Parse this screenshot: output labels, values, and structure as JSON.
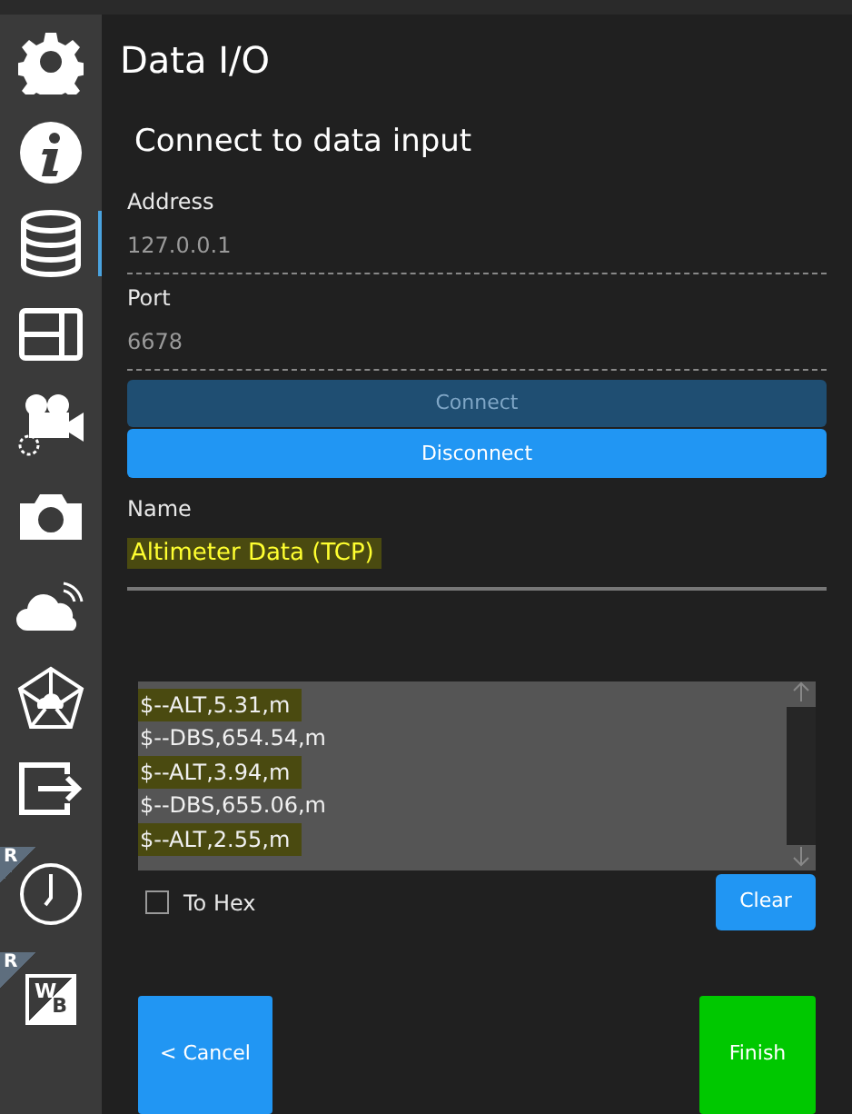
{
  "sidebar": {
    "items": [
      {
        "selected": false
      },
      {
        "selected": false
      },
      {
        "selected": true
      },
      {
        "selected": false
      },
      {
        "selected": false
      },
      {
        "selected": false
      },
      {
        "selected": false
      },
      {
        "selected": false
      },
      {
        "selected": false
      },
      {
        "selected": false,
        "badge": "R"
      },
      {
        "selected": false,
        "badge": "R",
        "glyph_top": "W",
        "glyph_bottom": "B"
      }
    ]
  },
  "title": "Data I/O",
  "section_title": "Connect to data input",
  "fields": [
    {
      "label": "Address",
      "value": "127.0.0.1"
    },
    {
      "label": "Port",
      "value": "6678"
    }
  ],
  "connect_button": {
    "label": "Connect",
    "disabled": true
  },
  "disconnect_button": {
    "label": "Disconnect",
    "disabled": false
  },
  "name_field": {
    "label": "Name",
    "value": "Altimeter Data (TCP)",
    "highlighted": true
  },
  "log": {
    "lines": [
      {
        "text": "$--ALT,5.31,m",
        "highlighted": true
      },
      {
        "text": "$--DBS,654.54,m",
        "highlighted": false
      },
      {
        "text": "$--ALT,3.94,m",
        "highlighted": true
      },
      {
        "text": "$--DBS,655.06,m",
        "highlighted": false
      },
      {
        "text": "$--ALT,2.55,m",
        "highlighted": true
      }
    ]
  },
  "to_hex": {
    "label": "To Hex",
    "checked": false
  },
  "clear_button": "Clear",
  "cancel_button": "< Cancel",
  "finish_button": "Finish"
}
